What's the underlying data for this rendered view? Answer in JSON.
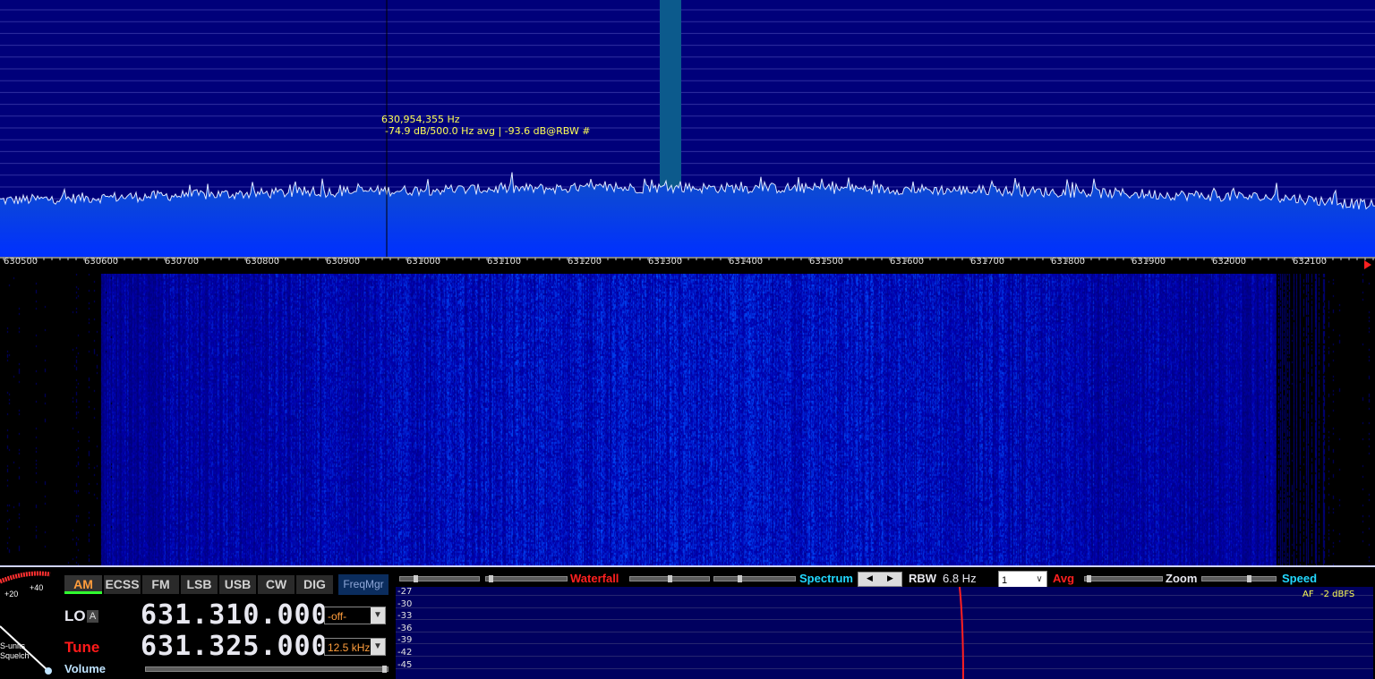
{
  "spectrum": {
    "cursor_freq": "630,954,355 Hz",
    "cursor_level": "-74.9 dB/500.0 Hz avg | -93.6 dB@RBW #",
    "freq_ticks": [
      "630500",
      "630600",
      "630700",
      "630800",
      "630900",
      "631000",
      "631100",
      "631200",
      "631300",
      "631400",
      "631500",
      "631600",
      "631700",
      "631800",
      "631900",
      "632000",
      "632100"
    ]
  },
  "modes": [
    "AM",
    "ECSS",
    "FM",
    "LSB",
    "USB",
    "CW",
    "DIG"
  ],
  "active_mode": "AM",
  "freqmgr_label": "FreqMgr",
  "smeter": {
    "label_20": "+20",
    "label_40": "+40",
    "sunits_label": "S-units",
    "squelch_label": "Squelch"
  },
  "lo": {
    "label": "LO",
    "badge": "A",
    "frequency": "631.310.000",
    "offset_option": "-off-"
  },
  "tune": {
    "label": "Tune",
    "frequency": "631.325.000",
    "step_option": "12.5 kHz"
  },
  "volume_label": "Volume",
  "display_controls": {
    "waterfall_label": "Waterfall",
    "spectrum_label": "Spectrum",
    "rbw_label": "RBW",
    "rbw_value": "6.8 Hz",
    "avg_value": "1",
    "avg_label": "Avg",
    "zoom_label": "Zoom",
    "speed_label": "Speed"
  },
  "audio_panel": {
    "af_label": "AF",
    "af_value": "-2 dBFS",
    "db_ticks": [
      "-27",
      "-30",
      "-33",
      "-36",
      "-39",
      "-42",
      "-45"
    ]
  },
  "colors": {
    "spectrum_bg": "#00007a",
    "trace": "#dfe8ff",
    "cursor_text": "#ffff55",
    "active_mode": "#ff9d3c",
    "tune_label": "#ff1a1a",
    "cyan_label": "#22d8ff",
    "red_label": "#ff2020",
    "freq_text": "#e8e8f0"
  }
}
